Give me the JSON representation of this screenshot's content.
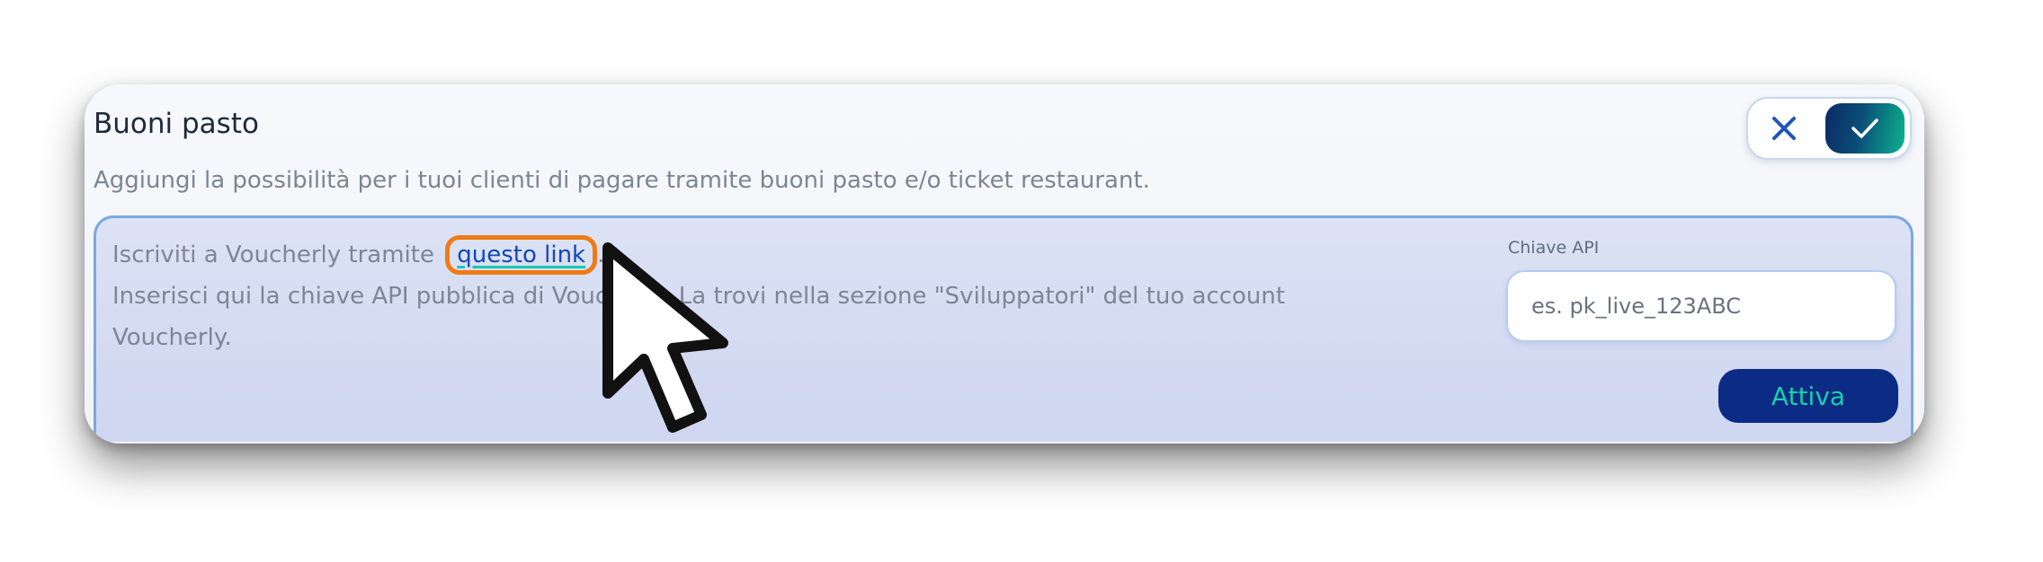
{
  "card": {
    "title": "Buoni pasto",
    "subtitle": "Aggiungi la possibilità per i tuoi clienti di pagare tramite buoni pasto e/o ticket restaurant."
  },
  "toggle": {
    "off_icon": "close-icon",
    "on_icon": "check-icon",
    "state": "on"
  },
  "instructions": {
    "line1_prefix": "Iscriviti a Voucherly tramite",
    "link_text": "questo link",
    "line1_suffix": ".",
    "line2": "Inserisci qui la chiave API pubblica di Voucherly. La trovi nella sezione \"Sviluppatori\" del tuo account Voucherly."
  },
  "api": {
    "label": "Chiave API",
    "placeholder": "es. pk_live_123ABC",
    "value": ""
  },
  "activate_button": {
    "label": "Attiva"
  },
  "colors": {
    "accent_navy": "#0b2b85",
    "accent_teal": "#18d0a8",
    "highlight_orange": "#f07a16",
    "link_blue": "#1346b8"
  }
}
